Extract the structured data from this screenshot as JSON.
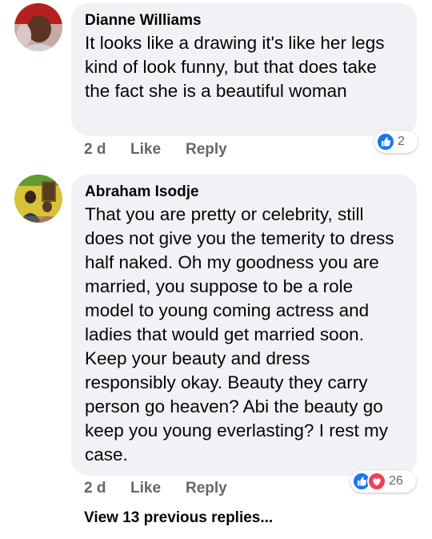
{
  "comments": [
    {
      "author": "Dianne Williams",
      "text": "It looks like a drawing it's like her legs kind of look funny, but that does take the fact she is a beautiful woman",
      "time": "2 d",
      "like_label": "Like",
      "reply_label": "Reply",
      "reaction_count": "2",
      "reactions": [
        "like"
      ]
    },
    {
      "author": "Abraham Isodje",
      "text": "That you are pretty or celebrity, still does not give you the temerity to dress half naked. Oh my goodness you are married, you suppose to be a role model to young coming actress and ladies that would get married soon. Keep your beauty and dress responsibly okay. Beauty they carry person go heaven? Abi the beauty go keep you young everlasting?  I rest my case.",
      "time": "2 d",
      "like_label": "Like",
      "reply_label": "Reply",
      "reaction_count": "26",
      "reactions": [
        "like",
        "love"
      ]
    }
  ],
  "view_more_label": "View 13 previous replies...",
  "colors": {
    "bubble": "#f0f2f5",
    "meta_text": "#65676b",
    "like_blue": "#1877f2",
    "love_red": "#f33e58"
  }
}
